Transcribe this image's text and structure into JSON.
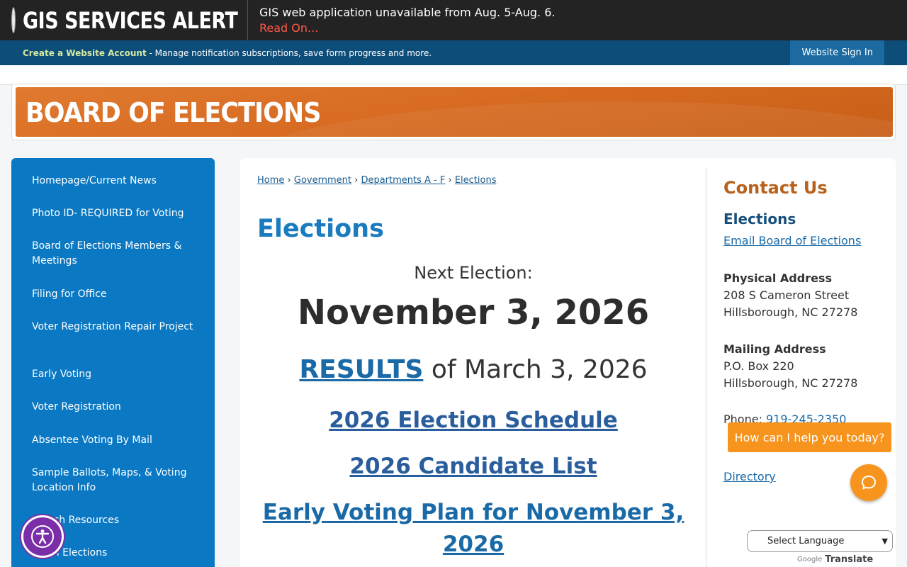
{
  "alert": {
    "title": "GIS SERVICES ALERT",
    "message": "GIS web application unavailable from Aug. 5-Aug. 6.",
    "read_on": "Read On..."
  },
  "account_bar": {
    "create_label": "Create a Website Account",
    "description": " - Manage notification subscriptions, save form progress and more.",
    "sign_in": "Website Sign In"
  },
  "banner": {
    "title": "BOARD OF ELECTIONS"
  },
  "sidebar": {
    "items": [
      {
        "label": "Homepage/Current News"
      },
      {
        "label": "Photo ID- REQUIRED for Voting"
      },
      {
        "label": "Board of Elections Members & Meetings"
      },
      {
        "label": "Filing for Office"
      },
      {
        "label": "Voter Registration Repair Project"
      },
      {
        "label": "Early Voting"
      },
      {
        "label": "Voter Registration"
      },
      {
        "label": "Absentee Voting By Mail"
      },
      {
        "label": "Sample Ballots, Maps, & Voting Location Info"
      },
      {
        "label": "...each Resources"
      },
      {
        "label": "...k in Elections"
      }
    ]
  },
  "breadcrumb": {
    "home": "Home",
    "government": "Government",
    "departments": "Departments A - F",
    "elections": "Elections",
    "sep": "›"
  },
  "main": {
    "title": "Elections",
    "next_label": "Next Election:",
    "next_date": "November 3, 2026",
    "results_link": "RESULTS",
    "results_suffix": " of March 3, 2026",
    "schedule_link": "2026 Election Schedule",
    "candidate_link": "2026 Candidate List",
    "early_voting_link": "Early Voting Plan for November 3, 2026"
  },
  "contact": {
    "title": "Contact Us",
    "dept": "Elections",
    "email": "Email Board of Elections",
    "physical_heading": "Physical Address",
    "physical_line1": "208 S Cameron Street",
    "physical_line2": "Hillsborough, NC 27278",
    "mailing_heading": "Mailing Address",
    "mailing_line1": "P.O. Box 220",
    "mailing_line2": "Hillsborough, NC 27278",
    "phone_label": "Phone: ",
    "phone_number": "919-245-2350",
    "directory": "Directory"
  },
  "chat": {
    "prompt": "How can I help you today?"
  },
  "translate": {
    "select_label": "Select Language",
    "google": "Google",
    "translate": "Translate"
  },
  "colors": {
    "alert_bg": "#232323",
    "account_bar_bg": "#0d4d7a",
    "sidebar_bg": "#0a78c2",
    "banner_orange": "#d66a20",
    "chat_orange": "#f7941d",
    "a11y_purple": "#7a2fa8"
  }
}
